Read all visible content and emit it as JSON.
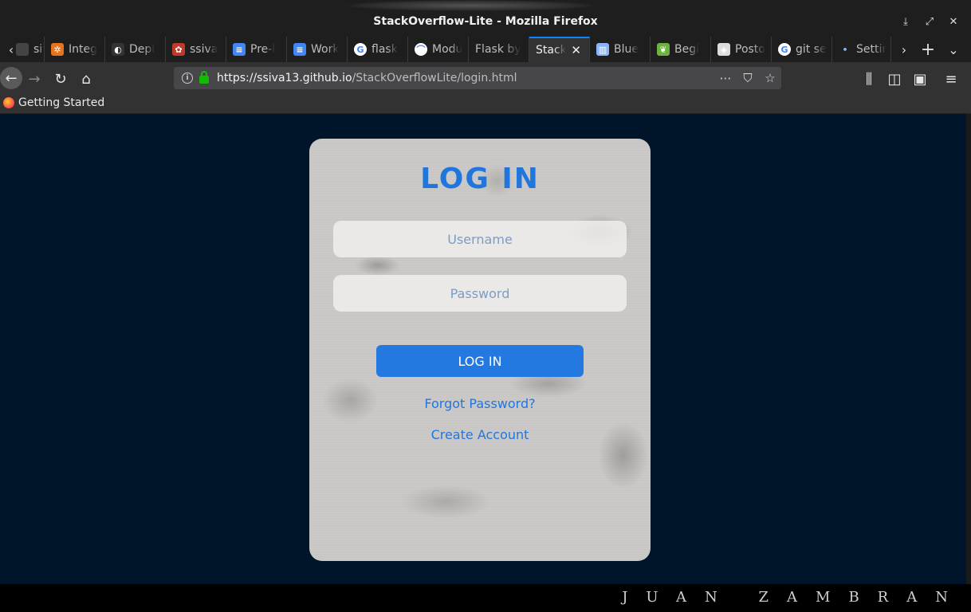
{
  "window": {
    "title": "StackOverflow-Lite - Mozilla Firefox"
  },
  "tabs": [
    {
      "label": "siva",
      "color": "#444",
      "glyph": ""
    },
    {
      "label": "Integ",
      "color": "#e8731a",
      "glyph": "✲"
    },
    {
      "label": "Depl",
      "color": "#333",
      "glyph": "◐"
    },
    {
      "label": "ssiva",
      "color": "#c0392b",
      "glyph": "✿"
    },
    {
      "label": "Pre-l",
      "color": "#4285f4",
      "glyph": "≡"
    },
    {
      "label": "Work",
      "color": "#4285f4",
      "glyph": "≡"
    },
    {
      "label": "flask",
      "color": "#ffffff",
      "glyph": "G"
    },
    {
      "label": "Modu",
      "color": "#ffffff",
      "glyph": "⌒"
    },
    {
      "label": "Flask by",
      "color": "",
      "glyph": ""
    },
    {
      "label": "Stack",
      "color": "",
      "glyph": "",
      "active": true
    },
    {
      "label": "Blue",
      "color": "#8ab4f8",
      "glyph": "▥"
    },
    {
      "label": "Begi",
      "color": "#6db33f",
      "glyph": "❦"
    },
    {
      "label": "Posto",
      "color": "#ddd",
      "glyph": "◈"
    },
    {
      "label": "git se",
      "color": "#ffffff",
      "glyph": "G"
    },
    {
      "label": "Settir",
      "color": "",
      "glyph": "•"
    }
  ],
  "nav": {
    "url_host": "https://ssiva13.github.io",
    "url_path": "/StackOverflowLite/login.html"
  },
  "bookmarks": [
    {
      "label": "Getting Started"
    }
  ],
  "login": {
    "heading": "LOG IN",
    "username_placeholder": "Username",
    "password_placeholder": "Password",
    "submit_label": "LOG IN",
    "forgot_label": "Forgot Password?",
    "create_label": "Create Account"
  },
  "taskbar": {
    "signature": "JUAN ZAMBRAN"
  },
  "colors": {
    "page_bg": "#00142a",
    "accent": "#2176de",
    "button": "#2379df"
  }
}
